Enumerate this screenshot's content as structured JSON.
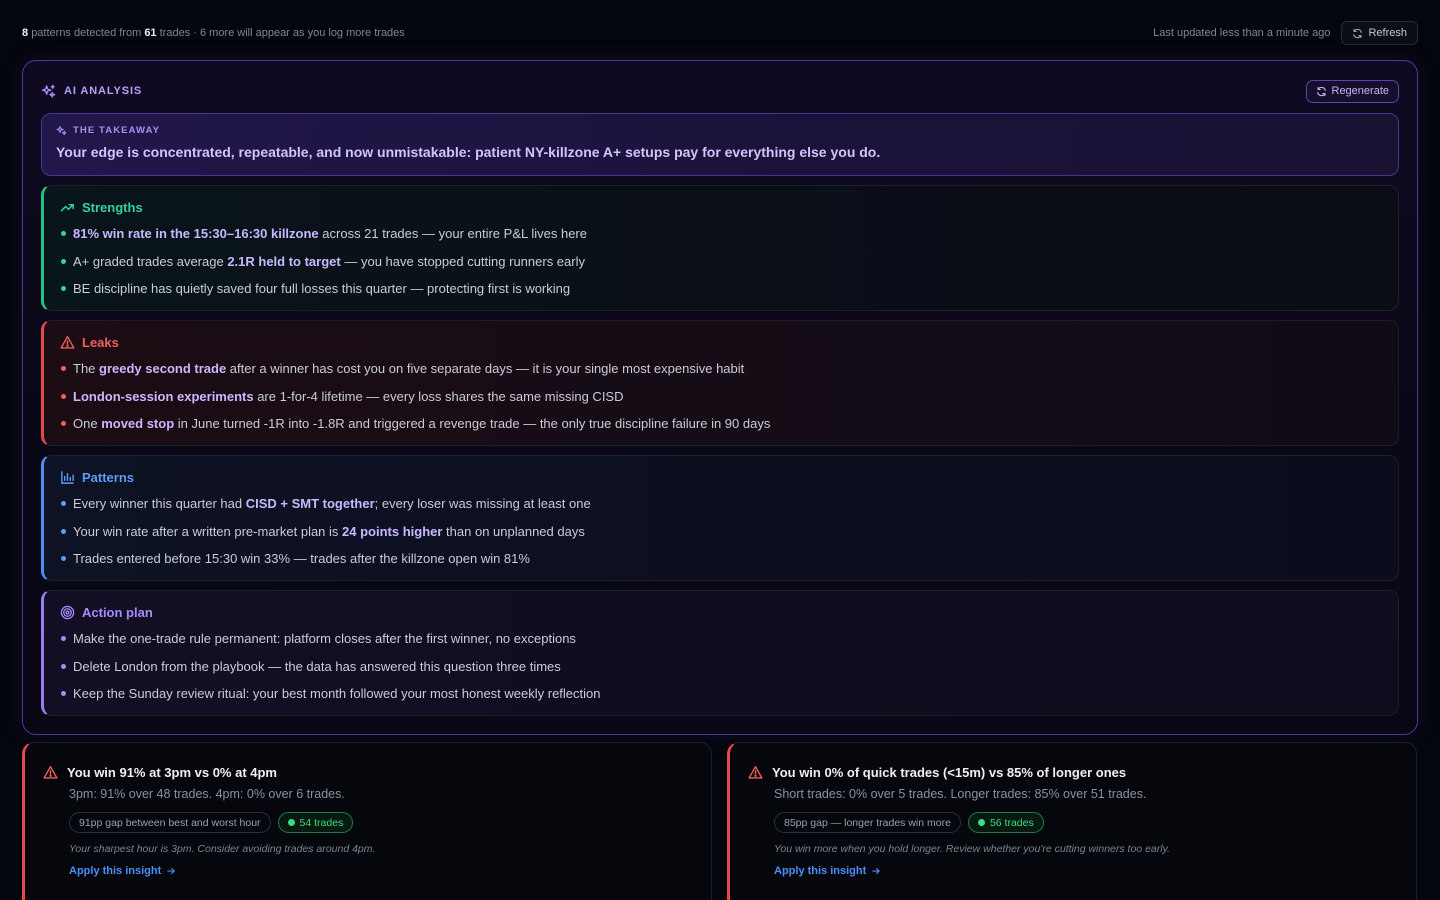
{
  "topbar": {
    "pattern_count": "8",
    "patterns_text": "patterns detected from",
    "trade_count": "61",
    "trades_text": "trades · 6 more will appear as you log more trades",
    "last_updated": "Last updated less than a minute ago",
    "refresh_label": "Refresh"
  },
  "ai": {
    "title": "AI ANALYSIS",
    "regenerate_label": "Regenerate",
    "takeaway_label": "THE TAKEAWAY",
    "takeaway_text": "Your edge is concentrated, repeatable, and now unmistakable: patient NY-killzone A+ setups pay for everything else you do."
  },
  "sections": {
    "strengths": {
      "title": "Strengths",
      "items": [
        {
          "pre": "",
          "bold": "81% win rate in the 15:30–16:30 killzone",
          "post": " across 21 trades — your entire P&L lives here"
        },
        {
          "pre": "A+ graded trades average ",
          "bold": "2.1R held to target",
          "post": " — you have stopped cutting runners early"
        },
        {
          "pre": "BE discipline has quietly saved four full losses this quarter — protecting first is working",
          "bold": "",
          "post": ""
        }
      ]
    },
    "leaks": {
      "title": "Leaks",
      "items": [
        {
          "pre": "The ",
          "bold": "greedy second trade",
          "post": " after a winner has cost you on five separate days — it is your single most expensive habit"
        },
        {
          "pre": "",
          "bold": "London-session experiments",
          "post": " are 1-for-4 lifetime — every loss shares the same missing CISD"
        },
        {
          "pre": "One ",
          "bold": "moved stop",
          "post": " in June turned -1R into -1.8R and triggered a revenge trade — the only true discipline failure in 90 days"
        }
      ]
    },
    "patterns": {
      "title": "Patterns",
      "items": [
        {
          "pre": "Every winner this quarter had ",
          "bold": "CISD + SMT together",
          "post": "; every loser was missing at least one"
        },
        {
          "pre": "Your win rate after a written pre-market plan is ",
          "bold": "24 points higher",
          "post": " than on unplanned days"
        },
        {
          "pre": "Trades entered before 15:30 win 33% — trades after the killzone open win 81%",
          "bold": "",
          "post": ""
        }
      ]
    },
    "action": {
      "title": "Action plan",
      "items": [
        {
          "pre": "Make the one-trade rule permanent: platform closes after the first winner, no exceptions",
          "bold": "",
          "post": ""
        },
        {
          "pre": "Delete London from the playbook — the data has answered this question three times",
          "bold": "",
          "post": ""
        },
        {
          "pre": "Keep the Sunday review ritual: your best month followed your most honest weekly reflection",
          "bold": "",
          "post": ""
        }
      ]
    }
  },
  "insights": [
    {
      "title": "You win 91% at 3pm vs 0% at 4pm",
      "subtitle": "3pm: 91% over 48 trades. 4pm: 0% over 6 trades.",
      "chip": "91pp gap between best and worst hour",
      "trades_chip": "54 trades",
      "note": "Your sharpest hour is 3pm. Consider avoiding trades around 4pm.",
      "link": "Apply this insight"
    },
    {
      "title": "You win 0% of quick trades (<15m) vs 85% of longer ones",
      "subtitle": "Short trades: 0% over 5 trades. Longer trades: 85% over 51 trades.",
      "chip": "85pp gap — longer trades win more",
      "trades_chip": "56 trades",
      "note": "You win more when you hold longer. Review whether you're cutting winners too early.",
      "link": "Apply this insight"
    }
  ],
  "colors": {
    "accent_purple": "#a78bfa",
    "strengths": "#34d399",
    "leaks": "#f0605f",
    "patterns": "#5c9cf8",
    "action": "#a78bfa",
    "link": "#4d8ef7",
    "trades_chip": "#3ddc84"
  },
  "icons": {
    "refresh": "refresh-icon",
    "ai": "sparkles-icon",
    "regenerate": "refresh-icon",
    "takeaway": "sparkles-icon",
    "strengths": "trending-up-icon",
    "leaks": "warning-triangle-icon",
    "patterns": "bar-chart-icon",
    "action": "target-icon",
    "insight": "warning-triangle-icon",
    "link": "arrow-right-icon"
  }
}
